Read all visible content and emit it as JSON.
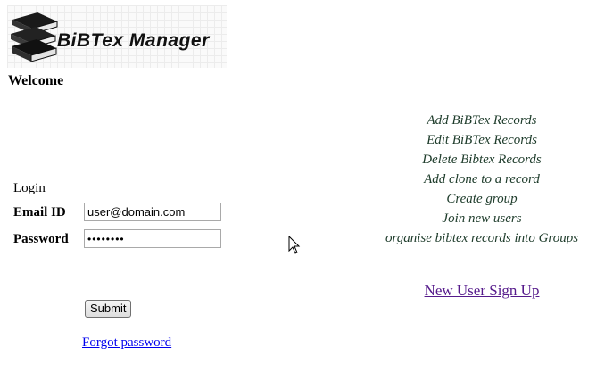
{
  "logo": {
    "text": "BiBTex Manager",
    "icon": "books-icon"
  },
  "welcome": "Welcome",
  "login": {
    "title": "Login",
    "email_label": "Email ID",
    "email_value": "user@domain.com",
    "password_label": "Password",
    "password_value": "••••••••",
    "submit_label": "Submit",
    "forgot_label": "Forgot password"
  },
  "features": [
    "Add BiBTex Records",
    "Edit BiBTex Records",
    "Delete Bibtex Records",
    "Add clone to a record",
    "Create group",
    "Join new users",
    "organise bibtex records into Groups"
  ],
  "signup_label": "New User Sign Up",
  "colors": {
    "link": "#0000ee",
    "visited_link": "#551a8b",
    "feature_text": "#1d3b2a"
  }
}
